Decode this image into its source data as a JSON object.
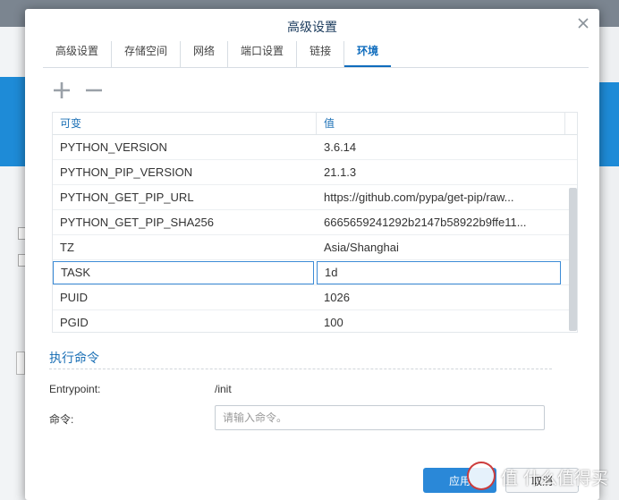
{
  "dialog": {
    "title": "高级设置",
    "close_icon": "close-icon"
  },
  "tabs": [
    {
      "label": "高级设置",
      "active": false
    },
    {
      "label": "存储空间",
      "active": false
    },
    {
      "label": "网络",
      "active": false
    },
    {
      "label": "端口设置",
      "active": false
    },
    {
      "label": "链接",
      "active": false
    },
    {
      "label": "环境",
      "active": true
    }
  ],
  "toolbar": {
    "add_icon": "plus-icon",
    "remove_icon": "minus-icon"
  },
  "env_table": {
    "headers": [
      "可变",
      "值"
    ],
    "rows": [
      {
        "name": "PYTHON_VERSION",
        "value": "3.6.14"
      },
      {
        "name": "PYTHON_PIP_VERSION",
        "value": "21.1.3"
      },
      {
        "name": "PYTHON_GET_PIP_URL",
        "value": "https://github.com/pypa/get-pip/raw..."
      },
      {
        "name": "PYTHON_GET_PIP_SHA256",
        "value": "6665659241292b2147b58922b9ffe11..."
      },
      {
        "name": "TZ",
        "value": "Asia/Shanghai"
      },
      {
        "name": "TASK",
        "value": "1d",
        "editing": true
      },
      {
        "name": "PUID",
        "value": "1026"
      },
      {
        "name": "PGID",
        "value": "100"
      }
    ]
  },
  "exec": {
    "section_title": "执行命令",
    "entrypoint_label": "Entrypoint:",
    "entrypoint_value": "/init",
    "command_label": "命令:",
    "command_placeholder": "请输入命令。",
    "command_value": ""
  },
  "footer": {
    "apply_label": "应用",
    "cancel_label": "取消"
  },
  "watermark": {
    "text": "值 什么值得买"
  },
  "colors": {
    "accent": "#2a88d8",
    "header_text": "#1a6fb5",
    "background_blue": "#1e8bd7"
  }
}
